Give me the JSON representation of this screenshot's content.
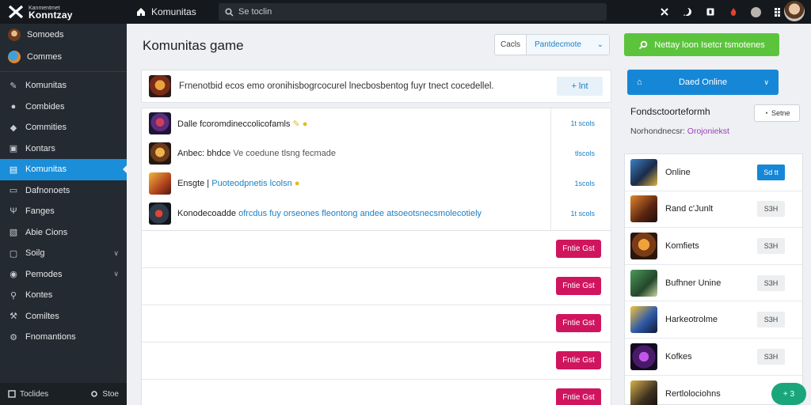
{
  "app": {
    "logo_small": "Kanmentmet",
    "logo_big": "Konntzay",
    "home_label": "Komunitas",
    "search_placeholder": "Se toclin"
  },
  "sidebar": {
    "top_items": [
      {
        "label": "Somoeds",
        "icon": "avatar-icon"
      },
      {
        "label": "Commes",
        "icon": "globe-icon"
      }
    ],
    "items": [
      {
        "label": "Komunitas",
        "icon": "pencil-icon",
        "active": false,
        "chevron": false
      },
      {
        "label": "Combides",
        "icon": "person-icon",
        "active": false,
        "chevron": false
      },
      {
        "label": "Commities",
        "icon": "people-icon",
        "active": false,
        "chevron": false
      },
      {
        "label": "Kontars",
        "icon": "game-icon",
        "active": false,
        "chevron": false
      },
      {
        "label": "Komunitas",
        "icon": "list-icon",
        "active": true,
        "chevron": false
      },
      {
        "label": "Dafnonoets",
        "icon": "card-icon",
        "active": false,
        "chevron": false
      },
      {
        "label": "Fanges",
        "icon": "tree-icon",
        "active": false,
        "chevron": false
      },
      {
        "label": "Abie Cions",
        "icon": "image-icon",
        "active": false,
        "chevron": false
      },
      {
        "label": "Soilg",
        "icon": "box-icon",
        "active": false,
        "chevron": true
      },
      {
        "label": "Pemodes",
        "icon": "chat-icon",
        "active": false,
        "chevron": true
      },
      {
        "label": "Kontes",
        "icon": "key-icon",
        "active": false,
        "chevron": false
      },
      {
        "label": "Comiltes",
        "icon": "wrench-icon",
        "active": false,
        "chevron": false
      },
      {
        "label": "Fnomantions",
        "icon": "settings-icon",
        "active": false,
        "chevron": false
      }
    ],
    "bottom_left": "Toclides",
    "bottom_right": "Stoe"
  },
  "main": {
    "title": "Komunitas game",
    "filter_left": "Cacls",
    "filter_right": "Pantdecmote",
    "post_box": {
      "text": "Frnenotbid ecos emo oronihisbogrcocurel lnecbosbentog fuyr tnect cocedellel.",
      "button": "+ lnt"
    },
    "feed": [
      {
        "title": "Dalle fcoromdineccolicofamls",
        "highlight": "",
        "meta": "1t scols"
      },
      {
        "title": "Anbec: bhdce",
        "highlight": "",
        "rest": "Ve coedune tlsng fecmade",
        "meta": "tlscols"
      },
      {
        "title": "Ensgte |",
        "highlight": "Puoteodpnetis lcolsn",
        "meta": "1scols"
      },
      {
        "title": "Konodecoadde",
        "highlight": "ofrcdus fuy orseones fleontong andee atsoeotsnecsmolecotiely",
        "meta": "1t scols"
      }
    ],
    "row_button": "Fntie Gst",
    "rows_count": 5
  },
  "right": {
    "green_button": "Nettay loon Isetcr tsmotenes",
    "blue_button": "Daed Online",
    "stats_title": "Fondsctoorteformh",
    "stats_sub_label": "Norhondnecsr:",
    "stats_sub_value": "Orojoniekst",
    "settings_button": "Setne",
    "games": [
      {
        "name": "Online",
        "tag": "Sd tt",
        "active": true
      },
      {
        "name": "Rand c'Junlt",
        "tag": "S3H",
        "active": false
      },
      {
        "name": "Komfiets",
        "tag": "S3H",
        "active": false
      },
      {
        "name": "Bufhner Unine",
        "tag": "S3H",
        "active": false
      },
      {
        "name": "Harkeotrolme",
        "tag": "S3H",
        "active": false
      },
      {
        "name": "Kofkes",
        "tag": "S3H",
        "active": false
      },
      {
        "name": "Rertlolociohns",
        "tag": "",
        "active": false
      }
    ],
    "fab": "+ 3"
  },
  "colors": {
    "accent_blue": "#1587d6",
    "green": "#5cc43c",
    "pink": "#d0155f",
    "sidebar_bg": "#242a31",
    "topbar_bg": "#15191e"
  }
}
